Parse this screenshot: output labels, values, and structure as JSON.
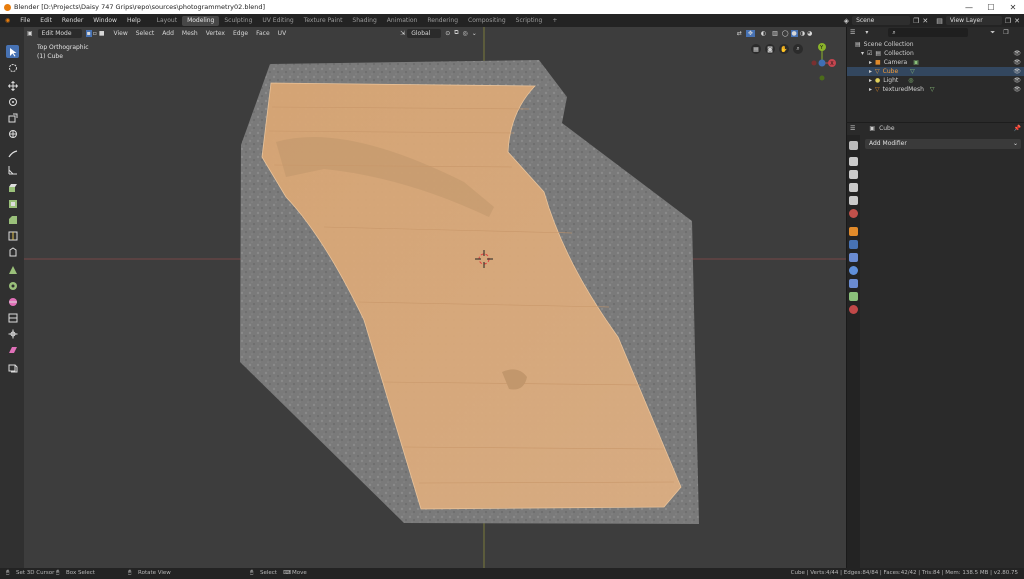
{
  "window": {
    "title": "Blender [D:\\Projects\\Daisy 747 Grips\\repo\\sources\\photogrammetry02.blend]",
    "controls": [
      "—",
      "☐",
      "✕"
    ]
  },
  "menu": [
    "File",
    "Edit",
    "Render",
    "Window",
    "Help"
  ],
  "workspaces": [
    {
      "label": "Layout",
      "active": false
    },
    {
      "label": "Modeling",
      "active": true
    },
    {
      "label": "Sculpting",
      "active": false
    },
    {
      "label": "UV Editing",
      "active": false
    },
    {
      "label": "Texture Paint",
      "active": false
    },
    {
      "label": "Shading",
      "active": false
    },
    {
      "label": "Animation",
      "active": false
    },
    {
      "label": "Rendering",
      "active": false
    },
    {
      "label": "Compositing",
      "active": false
    },
    {
      "label": "Scripting",
      "active": false
    },
    {
      "label": "+",
      "active": false
    }
  ],
  "scene": {
    "label": "Scene",
    "view_layer": "View Layer"
  },
  "viewport": {
    "mode": "Edit Mode",
    "menus": [
      "View",
      "Select",
      "Add",
      "Mesh",
      "Vertex",
      "Edge",
      "Face",
      "UV"
    ],
    "orientation": "Global",
    "view_name": "Top Orthographic",
    "object_label": "(1) Cube"
  },
  "gizmo": {
    "y_label": "Y",
    "x_label": "X"
  },
  "outliner": {
    "root": "Scene Collection",
    "collection": "Collection",
    "items": [
      {
        "name": "Camera",
        "color": "#e18a2a"
      },
      {
        "name": "Light",
        "color": "#e1d15a"
      },
      {
        "name": "Cube",
        "color": "#f29d3c",
        "selected": true
      },
      {
        "name": "texturedMesh",
        "color": "#e18a2a"
      }
    ]
  },
  "properties": {
    "object_name": "Cube",
    "add_modifier": "Add Modifier"
  },
  "status": {
    "left": [
      {
        "label": "Set 3D Cursor"
      },
      {
        "label": "Box Select"
      },
      {
        "label": "Rotate View"
      },
      {
        "label": "Select"
      },
      {
        "label": "Move"
      }
    ],
    "right": "Cube | Verts:4/44 | Edges:84/84 | Faces:42/42 | Tris:84 | Mem: 138.5 MB | v2.80.75"
  },
  "colors": {
    "accent": "#4772b3",
    "mesh": "#d8a878",
    "scan": "#7a7a7a",
    "viewport_bg": "#3d3d3d"
  }
}
